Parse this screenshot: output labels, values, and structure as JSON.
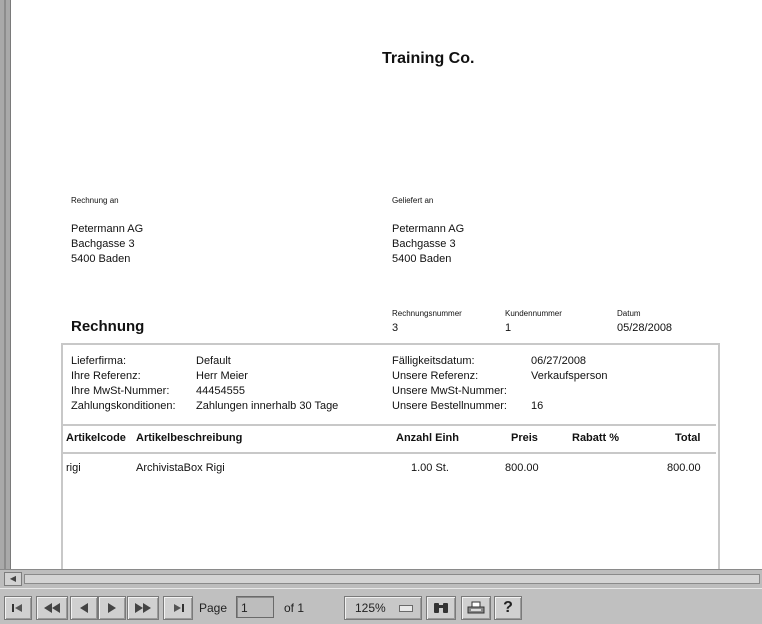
{
  "document": {
    "company": "Training Co.",
    "bill_to": {
      "label": "Rechnung an",
      "lines": [
        "Petermann AG",
        "Bachgasse 3",
        "5400 Baden"
      ]
    },
    "ship_to": {
      "label": "Geliefert an",
      "lines": [
        "Petermann AG",
        "Bachgasse 3",
        "5400 Baden"
      ]
    },
    "title": "Rechnung",
    "meta": [
      {
        "label": "Rechnungsnummer",
        "value": "3"
      },
      {
        "label": "Kundennummer",
        "value": "1"
      },
      {
        "label": "Datum",
        "value": "05/28/2008"
      }
    ],
    "info_left": [
      {
        "label": "Lieferfirma:",
        "value": "Default"
      },
      {
        "label": "Ihre Referenz:",
        "value": "Herr Meier"
      },
      {
        "label": "Ihre MwSt-Nummer:",
        "value": "44454555"
      },
      {
        "label": "Zahlungskonditionen:",
        "value": "Zahlungen innerhalb 30 Tage"
      }
    ],
    "info_right": [
      {
        "label": "Fälligkeitsdatum:",
        "value": "06/27/2008"
      },
      {
        "label": "Unsere Referenz:",
        "value": "Verkaufsperson"
      },
      {
        "label": "Unsere MwSt-Nummer:",
        "value": ""
      },
      {
        "label": "Unsere Bestellnummer:",
        "value": "16"
      }
    ],
    "table_headers": [
      "Artikelcode",
      "Artikelbeschreibung",
      "Anzahl Einh",
      "Preis",
      "Rabatt %",
      "Total"
    ],
    "rows": [
      {
        "code": "rigi",
        "desc": "ArchivistaBox Rigi",
        "qty": "1.00 St.",
        "price": "800.00",
        "discount": "",
        "total": "800.00"
      }
    ]
  },
  "toolbar": {
    "page_label": "Page",
    "page_value": "1",
    "of_label": "of 1",
    "zoom": "125%",
    "help": "?"
  },
  "icons": [
    "first-page-icon",
    "rewind-icon",
    "prev-page-icon",
    "next-page-icon",
    "fast-forward-icon",
    "last-page-icon",
    "find-icon",
    "print-icon",
    "help-icon",
    "scroll-left-icon"
  ]
}
